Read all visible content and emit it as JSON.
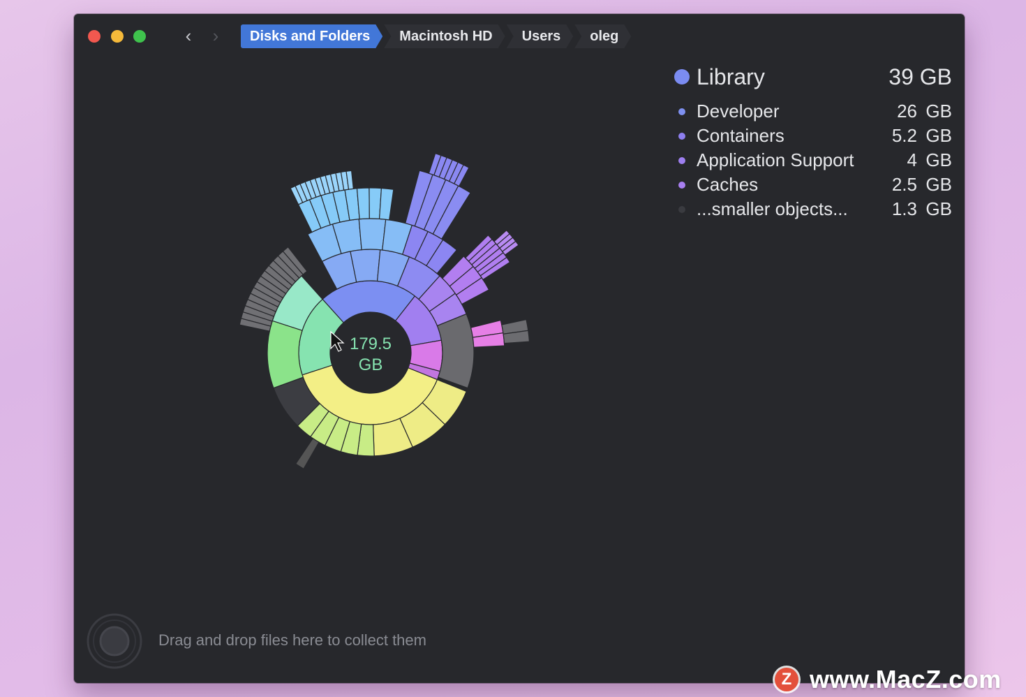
{
  "titlebar": {
    "nav_back_icon": "chevron-left-icon",
    "nav_forward_icon": "chevron-right-icon"
  },
  "breadcrumb": [
    {
      "label": "Disks and Folders",
      "active": true
    },
    {
      "label": "Macintosh HD",
      "active": false
    },
    {
      "label": "Users",
      "active": false
    },
    {
      "label": "oleg",
      "active": false
    }
  ],
  "center": {
    "value": "179.5",
    "unit": "GB"
  },
  "legend": {
    "title": "Library",
    "title_size": "39 GB",
    "title_color": "#7b8cf2",
    "items": [
      {
        "name": "Developer",
        "num": "26",
        "unit": "GB",
        "color": "#7e90f0"
      },
      {
        "name": "Containers",
        "num": "5.2",
        "unit": "GB",
        "color": "#8e7ff0"
      },
      {
        "name": "Application Support",
        "num": "4",
        "unit": "GB",
        "color": "#9e7ff0"
      },
      {
        "name": "Caches",
        "num": "2.5",
        "unit": "GB",
        "color": "#a87ff0"
      },
      {
        "name": "...smaller objects...",
        "num": "1.3",
        "unit": "GB",
        "color": "#3a3b40"
      }
    ]
  },
  "footer": {
    "drop_text": "Drag and drop files here to collect them"
  },
  "watermark": {
    "logo": "Z",
    "text": "www.MacZ.com"
  },
  "chart_data": {
    "type": "sunburst",
    "total": "179.5 GB",
    "segments": [
      {
        "name": "Library",
        "size_gb": 39,
        "children": [
          {
            "name": "Developer",
            "size_gb": 26
          },
          {
            "name": "Containers",
            "size_gb": 5.2
          },
          {
            "name": "Application Support",
            "size_gb": 4
          },
          {
            "name": "Caches",
            "size_gb": 2.5
          },
          {
            "name": "...smaller objects...",
            "size_gb": 1.3
          }
        ]
      }
    ]
  }
}
